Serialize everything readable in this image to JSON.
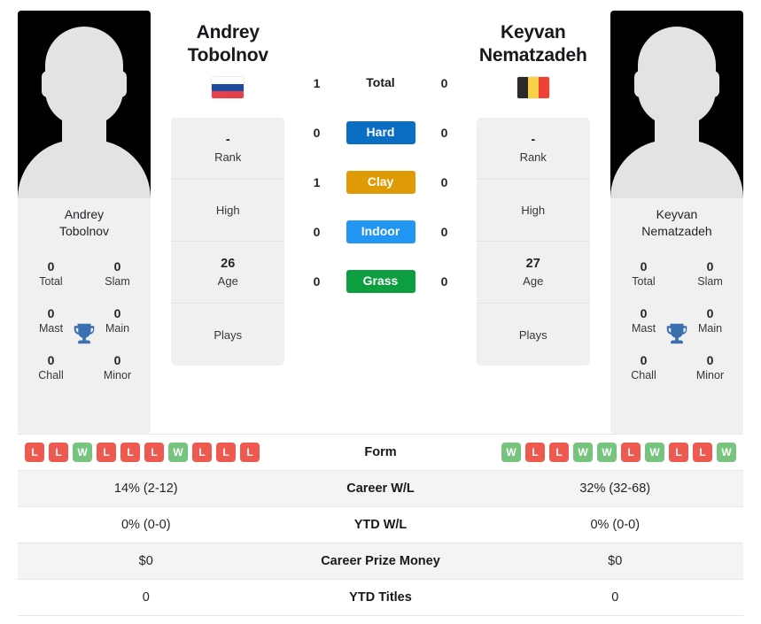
{
  "players": {
    "left": {
      "name": "Andrey Tobolnov",
      "name_line1": "Andrey",
      "name_line2": "Tobolnov",
      "photo_name_line1": "Andrey",
      "photo_name_line2": "Tobolnov",
      "country_flag": "russia-flag",
      "flag_colors": [
        "#ffffff",
        "#1b4ca0",
        "#e8404a"
      ],
      "info": {
        "rank_value": "-",
        "rank_label": "Rank",
        "high_value": "",
        "high_label": "High",
        "age_value": "26",
        "age_label": "Age",
        "plays_value": "",
        "plays_label": "Plays"
      },
      "titles": {
        "total_value": "0",
        "total_label": "Total",
        "slam_value": "0",
        "slam_label": "Slam",
        "mast_value": "0",
        "mast_label": "Mast",
        "main_value": "0",
        "main_label": "Main",
        "chall_value": "0",
        "chall_label": "Chall",
        "minor_value": "0",
        "minor_label": "Minor"
      },
      "surface_wins": {
        "total": "1",
        "hard": "0",
        "clay": "1",
        "indoor": "0",
        "grass": "0"
      },
      "form": [
        "L",
        "L",
        "W",
        "L",
        "L",
        "L",
        "W",
        "L",
        "L",
        "L"
      ],
      "career_wl": "14% (2-12)",
      "ytd_wl": "0% (0-0)",
      "career_prize_money": "$0",
      "ytd_titles": "0"
    },
    "right": {
      "name": "Keyvan Nematzadeh",
      "name_line1": "Keyvan",
      "name_line2": "Nematzadeh",
      "photo_name_line1": "Keyvan",
      "photo_name_line2": "Nematzadeh",
      "country_flag": "belgium-flag",
      "flag_colors": [
        "#2d2926",
        "#f8d147",
        "#ef4135"
      ],
      "info": {
        "rank_value": "-",
        "rank_label": "Rank",
        "high_value": "",
        "high_label": "High",
        "age_value": "27",
        "age_label": "Age",
        "plays_value": "",
        "plays_label": "Plays"
      },
      "titles": {
        "total_value": "0",
        "total_label": "Total",
        "slam_value": "0",
        "slam_label": "Slam",
        "mast_value": "0",
        "mast_label": "Mast",
        "main_value": "0",
        "main_label": "Main",
        "chall_value": "0",
        "chall_label": "Chall",
        "minor_value": "0",
        "minor_label": "Minor"
      },
      "surface_wins": {
        "total": "0",
        "hard": "0",
        "clay": "0",
        "indoor": "0",
        "grass": "0"
      },
      "form": [
        "W",
        "L",
        "L",
        "W",
        "W",
        "L",
        "W",
        "L",
        "L",
        "W"
      ],
      "career_wl": "32% (32-68)",
      "ytd_wl": "0% (0-0)",
      "career_prize_money": "$0",
      "ytd_titles": "0"
    }
  },
  "surfaces": {
    "total_label": "Total",
    "hard_label": "Hard",
    "clay_label": "Clay",
    "indoor_label": "Indoor",
    "grass_label": "Grass",
    "hard_color": "#0a6fc2",
    "clay_color": "#e09a06",
    "indoor_color": "#2196f3",
    "grass_color": "#0d9e3f"
  },
  "stats_rows": {
    "form_label": "Form",
    "career_wl_label": "Career W/L",
    "ytd_wl_label": "YTD W/L",
    "career_prize_money_label": "Career Prize Money",
    "ytd_titles_label": "YTD Titles"
  },
  "icons": {
    "trophy": "trophy-icon",
    "trophy_color": "#3a6fb0"
  }
}
